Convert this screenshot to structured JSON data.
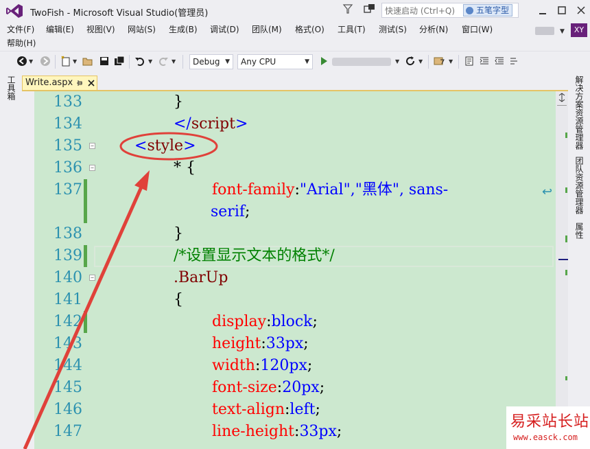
{
  "window": {
    "title": "TwoFish - Microsoft Visual Studio(管理员)",
    "quick_launch_placeholder": "快速启动 (Ctrl+Q)",
    "ime_label": "五笔字型",
    "account_initials": "XY"
  },
  "menu": {
    "items": [
      "文件(F)",
      "编辑(E)",
      "视图(V)",
      "网站(S)",
      "生成(B)",
      "调试(D)",
      "团队(M)",
      "格式(O)",
      "工具(T)",
      "测试(S)",
      "分析(N)",
      "窗口(W)",
      "帮助(H)"
    ]
  },
  "toolbar": {
    "configuration": "Debug",
    "platform": "Any CPU"
  },
  "left_panel": {
    "toolbox_label": "工具箱"
  },
  "right_panel": {
    "tabs": [
      "解决方案资源管理器",
      "团队资源管理器",
      "属性"
    ]
  },
  "document_tab": {
    "name": "Write.aspx"
  },
  "editor": {
    "line_numbers": [
      "133",
      "134",
      "135",
      "136",
      "137",
      "138",
      "139",
      "140",
      "141",
      "142",
      "143",
      "144",
      "145",
      "146",
      "147"
    ],
    "lines": {
      "l133": "}",
      "l134_open": "</",
      "l134_tag": "script",
      "l134_close": ">",
      "l135_open": "<",
      "l135_tag": "style",
      "l135_close": ">",
      "l136": "* {",
      "l137_prop": "font-family",
      "l137_colon": ":",
      "l137_val": "\"Arial\",\"黑体\", sans-",
      "l137_wrap": "serif",
      "l137_semi": ";",
      "l138": "}",
      "l139": "/*设置显示文本的格式*/",
      "l140": ".BarUp",
      "l141": "{",
      "l142_prop": "display",
      "l142_val": "block",
      "l143_prop": "height",
      "l143_val": "33px",
      "l144_prop": "width",
      "l144_val": "120px",
      "l145_prop": "font-size",
      "l145_val": "20px",
      "l146_prop": "text-align",
      "l146_val": "left",
      "l147_prop": "line-height",
      "l147_val": "33px",
      "colon": ":",
      "semi": ";"
    }
  },
  "watermark": {
    "brand": "易采站长站",
    "url": "www.easck.com"
  },
  "colors": {
    "editor_bg": "#cce8cf",
    "line_number": "#2b91af",
    "css_property": "#ff0000",
    "css_value": "#0000ff",
    "comment": "#008000",
    "annotation": "#e0413a",
    "vs_purple": "#68217a"
  }
}
